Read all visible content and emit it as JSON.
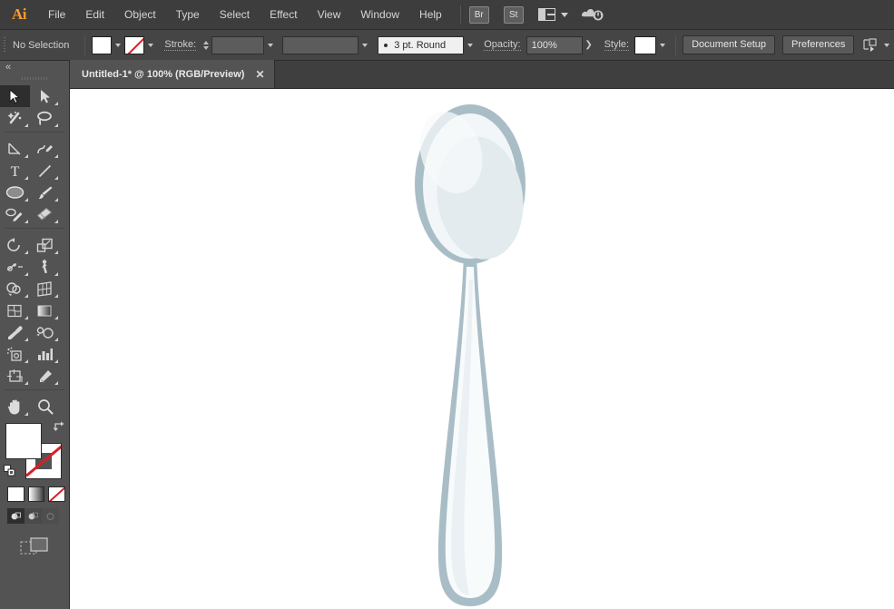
{
  "app": {
    "name": "Adobe Illustrator",
    "logo_text": "Ai",
    "accent_color": "#ff9a2e"
  },
  "menubar": {
    "items": [
      {
        "label": "File"
      },
      {
        "label": "Edit"
      },
      {
        "label": "Object"
      },
      {
        "label": "Type"
      },
      {
        "label": "Select"
      },
      {
        "label": "Effect"
      },
      {
        "label": "View"
      },
      {
        "label": "Window"
      },
      {
        "label": "Help"
      }
    ],
    "bridge_label": "Br",
    "stock_label": "St",
    "workspace_icon": "workspace-switcher-icon",
    "cc_icon": "creative-cloud-sync-icon"
  },
  "controlbar": {
    "selection_status": "No Selection",
    "fill_swatch": "#ffffff",
    "stroke_swatch": "none",
    "stroke_label": "Stroke:",
    "stroke_weight_value": "",
    "variable_width_value": "",
    "brush_definition": "3 pt. Round",
    "opacity_label": "Opacity:",
    "opacity_value": "100%",
    "style_label": "Style:",
    "style_swatch": "#ffffff",
    "document_setup_label": "Document Setup",
    "preferences_label": "Preferences",
    "align_icon": "align-to-selection-icon"
  },
  "tabbar": {
    "document_title": "Untitled-1* @ 100% (RGB/Preview)",
    "close_label": "✕"
  },
  "toolbar": {
    "tools": [
      {
        "name": "selection-tool",
        "active": true
      },
      {
        "name": "direct-selection-tool",
        "active": false
      },
      {
        "name": "magic-wand-tool",
        "active": false
      },
      {
        "name": "lasso-tool",
        "active": false
      },
      {
        "name": "pen-tool",
        "active": false
      },
      {
        "name": "curvature-tool",
        "active": false
      },
      {
        "name": "type-tool",
        "active": false
      },
      {
        "name": "line-segment-tool",
        "active": false
      },
      {
        "name": "ellipse-tool",
        "active": false
      },
      {
        "name": "paintbrush-tool",
        "active": false
      },
      {
        "name": "pencil-tool",
        "active": false
      },
      {
        "name": "eraser-tool",
        "active": false
      },
      {
        "name": "rotate-tool",
        "active": false
      },
      {
        "name": "scale-tool",
        "active": false
      },
      {
        "name": "width-tool",
        "active": false
      },
      {
        "name": "free-transform-tool",
        "active": false
      },
      {
        "name": "shape-builder-tool",
        "active": false
      },
      {
        "name": "perspective-grid-tool",
        "active": false
      },
      {
        "name": "mesh-tool",
        "active": false
      },
      {
        "name": "gradient-tool",
        "active": false
      },
      {
        "name": "eyedropper-tool",
        "active": false
      },
      {
        "name": "blend-tool",
        "active": false
      },
      {
        "name": "symbol-sprayer-tool",
        "active": false
      },
      {
        "name": "column-graph-tool",
        "active": false
      },
      {
        "name": "artboard-tool",
        "active": false
      },
      {
        "name": "slice-tool",
        "active": false
      },
      {
        "name": "hand-tool",
        "active": false
      },
      {
        "name": "zoom-tool",
        "active": false
      }
    ],
    "fill_color": "#ffffff",
    "stroke_color": "none",
    "color_mode_buttons": [
      "color-fill-icon",
      "gradient-fill-icon",
      "none-fill-icon"
    ],
    "draw_modes": [
      "draw-normal-icon",
      "draw-behind-icon",
      "draw-inside-icon"
    ],
    "screen_mode": "change-screen-mode-icon"
  },
  "canvas": {
    "background": "#ffffff",
    "artwork_name": "spoon-illustration",
    "colors": {
      "outline": "#a9bdc6",
      "body": "#eef3f5",
      "highlight": "#e2eaee",
      "inner_light": "#f7fafb"
    }
  }
}
